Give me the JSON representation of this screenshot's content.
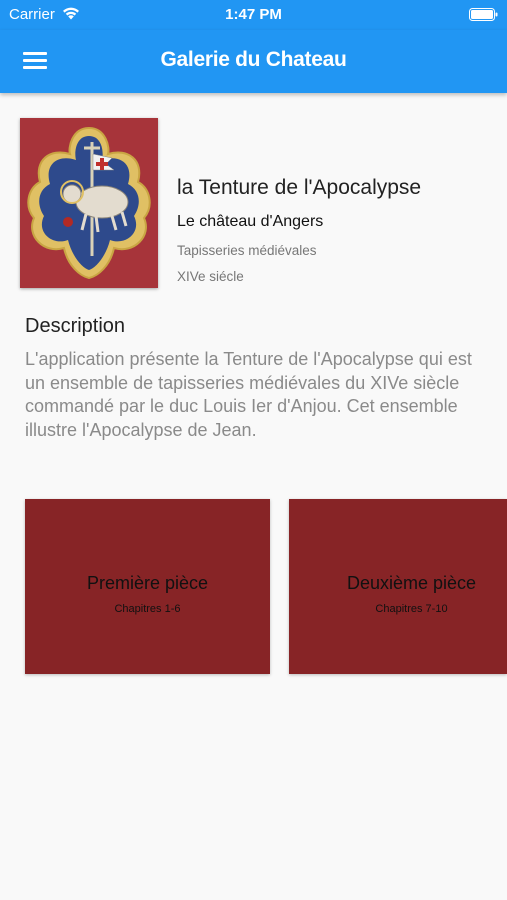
{
  "status_bar": {
    "carrier": "Carrier",
    "time": "1:47 PM"
  },
  "app_bar": {
    "title": "Galerie du Chateau",
    "menu_icon": "hamburger-menu-icon"
  },
  "header": {
    "cover_image": "apocalypse-lamb-emblem",
    "title": "la Tenture de l'Apocalypse",
    "subtitle": "Le château d'Angers",
    "category": "Tapisseries médiévales",
    "century": "XIVe siécle"
  },
  "description": {
    "heading": "Description",
    "text": "L'application présente la Tenture de l'Apocalypse qui est un ensemble de tapisseries médiévales du XIVe siècle commandé par le duc Louis Ier d'Anjou. Cet ensemble illustre l'Apocalypse de Jean."
  },
  "cards": [
    {
      "title": "Première pièce",
      "subtitle": "Chapitres 1-6"
    },
    {
      "title": "Deuxième pièce",
      "subtitle": "Chapitres 7-10"
    }
  ],
  "colors": {
    "primary": "#2196f3",
    "card": "#872426",
    "background": "#f9f9f9"
  }
}
